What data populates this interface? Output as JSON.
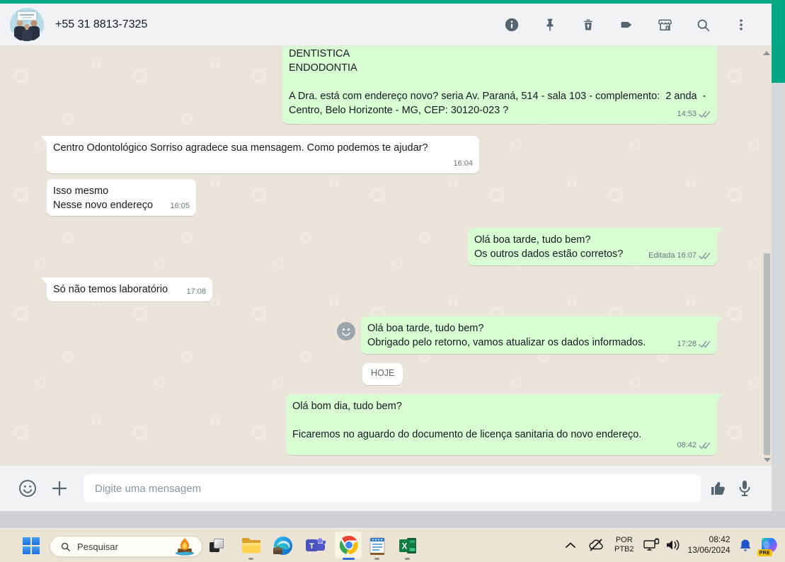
{
  "app": {
    "header": {
      "contact_name": "+55 31 8813-7325",
      "icons": [
        "info-icon",
        "pin-icon",
        "delete-icon",
        "label-icon",
        "storefront-icon",
        "search-icon",
        "more-options-icon"
      ]
    },
    "chat": {
      "date_divider": "HOJE",
      "messages": [
        {
          "direction": "out",
          "text": "DENTISTICA\nENDODONTIA\n\nA Dra. está com endereço novo? seria Av. Paraná, 514 - sala 103 - complemento:  2 anda  -  Centro, Belo Horizonte - MG, CEP: 30120-023 ?",
          "time": "14:53",
          "status": "delivered"
        },
        {
          "direction": "in",
          "text": "Centro Odontológico Sorriso agradece sua mensagem. Como podemos te ajudar?",
          "time": "16:04"
        },
        {
          "direction": "in",
          "text": "Isso mesmo\nNesse novo endereço",
          "time": "16:05"
        },
        {
          "direction": "out",
          "text": "Olá boa tarde, tudo bem?\nOs outros dados estão corretos?",
          "time": "16:07",
          "edited_label": "Editada",
          "status": "delivered"
        },
        {
          "direction": "in",
          "text": "Só não temos laboratório",
          "time": "17:08"
        },
        {
          "direction": "out",
          "text": "Olá boa tarde, tudo bem?\nObrigado pelo retorno, vamos atualizar os dados informados.",
          "time": "17:28",
          "status": "delivered"
        },
        {
          "direction": "out",
          "text": "Olá bom dia, tudo bem?\n\nFicaremos no aguardo do documento de licença sanitaria do novo endereço.",
          "time": "08:42",
          "status": "delivered"
        }
      ]
    },
    "composer": {
      "placeholder": "Digite uma mensagem"
    }
  },
  "taskbar": {
    "search_label": "Pesquisar",
    "tray": {
      "language_primary": "POR",
      "language_secondary": "PTB2",
      "time": "08:42",
      "date": "13/06/2024",
      "copilot_badge": "PRE"
    }
  },
  "colors": {
    "accent": "#00a884",
    "bubble_out": "#d9fdd3",
    "bubble_in": "#ffffff",
    "check_delivered": "#8696a0",
    "taskbar_bg": "#ebe3d3"
  }
}
